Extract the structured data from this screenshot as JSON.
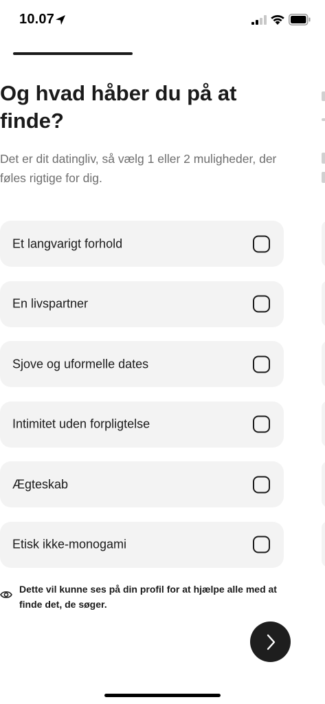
{
  "status_bar": {
    "time": "10.07",
    "icons": [
      "location-arrow-icon",
      "cellular-signal-icon",
      "wifi-icon",
      "battery-icon"
    ]
  },
  "progress": {
    "label": ""
  },
  "header": {
    "title": "Og hvad håber du på at finde?",
    "subtitle": "Det er dit datingliv, så vælg 1 eller 2 muligheder, der føles rigtige for dig."
  },
  "options": [
    {
      "label": "Et langvarigt forhold",
      "checked": false
    },
    {
      "label": "En livspartner",
      "checked": false
    },
    {
      "label": "Sjove og uformelle dates",
      "checked": false
    },
    {
      "label": "Intimitet uden forpligtelse",
      "checked": false
    },
    {
      "label": "Ægteskab",
      "checked": false
    },
    {
      "label": "Etisk ikke-monogami",
      "checked": false
    }
  ],
  "visibility_note": {
    "icon": "eye-icon",
    "text": "Dette vil kunne ses på din profil for at hjælpe alle med at finde det, de søger."
  },
  "next_button": {
    "icon": "chevron-right-icon"
  },
  "colors": {
    "card_background": "#f3f3f3",
    "text_primary": "#1a1a1a",
    "text_secondary": "#6e6e6e",
    "button_background": "#1e1e1e"
  }
}
